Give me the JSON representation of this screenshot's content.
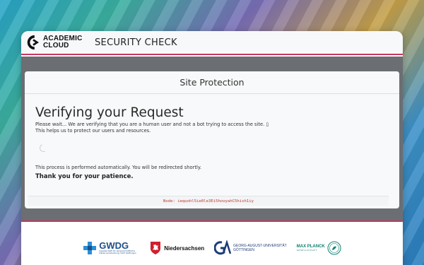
{
  "header": {
    "logo_line1": "ACADEMIC",
    "logo_line2": "CLOUD",
    "title": "SECURITY CHECK"
  },
  "card": {
    "header": "Site Protection",
    "heading": "Verifying your Request",
    "line1": "Please wait... We are verifying that you are a human user and not a bot trying to access the site. ▯",
    "line2": "This helps us to protect our users and resources.",
    "auto_text": "This process is performed automatically. You will be redirected shortly.",
    "thanks": "Thank you for your patience.",
    "node": "Node: iequohl5ie0le3Ei5hooyahC5hish1iy"
  },
  "footer": {
    "gwdg": "GWDG",
    "gwdg_sub": "Gesellschaft für wissenschaftliche Datenverarbeitung mbH Göttingen",
    "niedersachsen": "Niedersachsen",
    "goe_line1": "GEORG-AUGUST-UNIVERSITÄT",
    "goe_line2": "GÖTTINGEN",
    "mp_line1": "MAX PLANCK",
    "mp_line2": "GESELLSCHAFT"
  },
  "colors": {
    "accent": "#c9365f",
    "overlay": "#6b6e72",
    "node_text": "#c0392b"
  },
  "icons": [
    "academic-cloud-logo-icon",
    "loading-spinner-icon",
    "gwdg-logo-icon",
    "niedersachsen-horse-icon",
    "goettingen-ga-icon",
    "max-planck-seal-icon"
  ]
}
